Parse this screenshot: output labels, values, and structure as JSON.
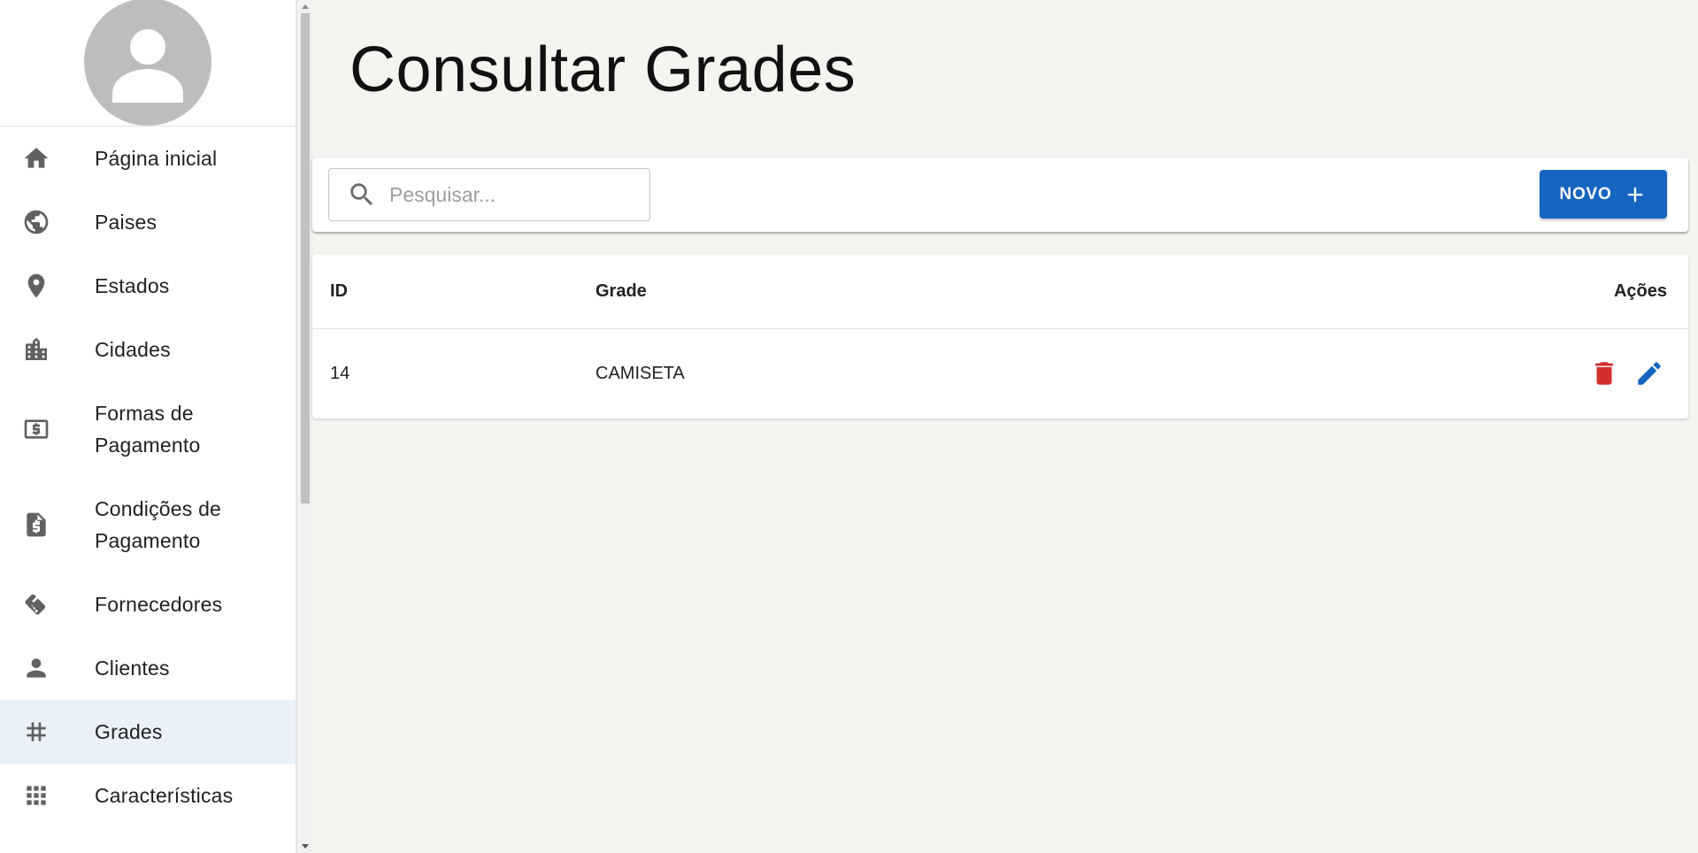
{
  "sidebar": {
    "items": [
      {
        "label": "Página inicial",
        "icon": "home-icon"
      },
      {
        "label": "Paises",
        "icon": "globe-icon"
      },
      {
        "label": "Estados",
        "icon": "location-pin-icon"
      },
      {
        "label": "Cidades",
        "icon": "city-icon"
      },
      {
        "label": "Formas de Pagamento",
        "icon": "money-icon"
      },
      {
        "label": "Condições de Pagamento",
        "icon": "receipt-dollar-icon"
      },
      {
        "label": "Fornecedores",
        "icon": "handshake-icon"
      },
      {
        "label": "Clientes",
        "icon": "person-icon"
      },
      {
        "label": "Grades",
        "icon": "hash-icon",
        "active": true
      },
      {
        "label": "Características",
        "icon": "grid-icon"
      }
    ]
  },
  "page": {
    "title": "Consultar Grades"
  },
  "toolbar": {
    "search_placeholder": "Pesquisar...",
    "new_label": "NOVO"
  },
  "table": {
    "columns": [
      "ID",
      "Grade",
      "Ações"
    ],
    "rows": [
      {
        "id": "14",
        "grade": "CAMISETA"
      }
    ]
  },
  "colors": {
    "accent": "#1565c0",
    "danger": "#d32f2f",
    "active_nav": "#eaf1f9",
    "background": "#f5f4f1"
  }
}
